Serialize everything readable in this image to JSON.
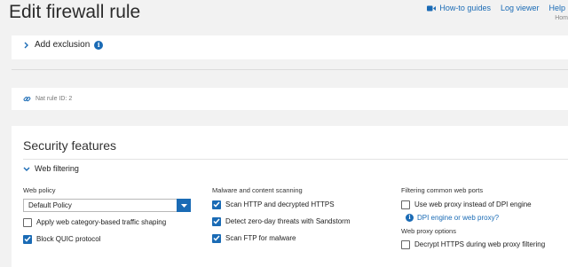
{
  "header": {
    "title": "Edit firewall rule",
    "links": [
      {
        "label": "How-to guides",
        "icon": "video-camera-icon"
      },
      {
        "label": "Log viewer",
        "icon": null
      },
      {
        "label": "Help",
        "icon": null
      }
    ],
    "breadcrumb": "Hom"
  },
  "exclusion": {
    "label": "Add exclusion",
    "info": "i"
  },
  "nat": {
    "label": "Nat rule ID: 2"
  },
  "security": {
    "title": "Security features",
    "web_filtering_label": "Web filtering",
    "web_policy": {
      "heading": "Web policy",
      "selected": "Default Policy",
      "checkboxes": [
        {
          "label": "Apply web category-based traffic shaping",
          "checked": false
        },
        {
          "label": "Block QUIC protocol",
          "checked": true
        }
      ]
    },
    "malware": {
      "heading": "Malware and content scanning",
      "checkboxes": [
        {
          "label": "Scan HTTP and decrypted HTTPS",
          "checked": true
        },
        {
          "label": "Detect zero-day threats with Sandstorm",
          "checked": true
        },
        {
          "label": "Scan FTP for malware",
          "checked": true
        }
      ]
    },
    "filtering_ports": {
      "heading": "Filtering common web ports",
      "checkboxes": [
        {
          "label": "Use web proxy instead of DPI engine",
          "checked": false
        }
      ],
      "info_link": "DPI engine or web proxy?",
      "proxy_options_heading": "Web proxy options",
      "proxy_checkboxes": [
        {
          "label": "Decrypt HTTPS during web proxy filtering",
          "checked": false
        }
      ]
    }
  },
  "colors": {
    "accent": "#1a6bb5",
    "background": "#f2f2f2",
    "panel": "#ffffff"
  }
}
